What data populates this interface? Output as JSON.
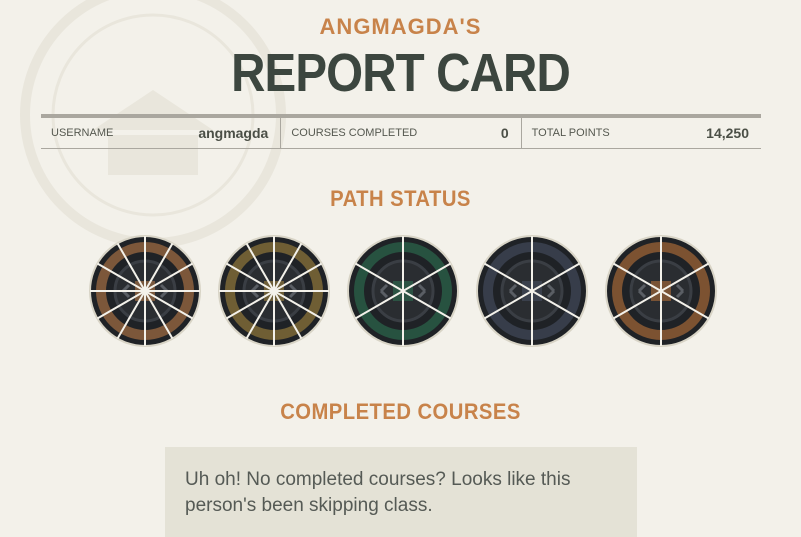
{
  "header": {
    "owner": "ANGMAGDA'S",
    "title": "REPORT CARD"
  },
  "stats": [
    {
      "label": "USERNAME",
      "value": "angmagda"
    },
    {
      "label": "COURSES COMPLETED",
      "value": "0"
    },
    {
      "label": "TOTAL POINTS",
      "value": "14,250"
    }
  ],
  "path_status": {
    "title": "PATH STATUS",
    "badges": [
      {
        "name": "path-badge-1",
        "segments": 12,
        "accent": "#c8834a",
        "base": "#2a2d31"
      },
      {
        "name": "path-badge-2",
        "segments": 12,
        "accent": "#b09040",
        "base": "#2a2d31"
      },
      {
        "name": "path-badge-3",
        "segments": 6,
        "accent": "#2e7a55",
        "base": "#2a2d31"
      },
      {
        "name": "path-badge-4",
        "segments": 6,
        "accent": "#4a5468",
        "base": "#2a2d31"
      },
      {
        "name": "path-badge-5",
        "segments": 6,
        "accent": "#c87a3a",
        "base": "#2a2d31"
      }
    ]
  },
  "completed_courses": {
    "title": "COMPLETED COURSES",
    "empty_message": "Uh oh! No completed courses? Looks like this person's been skipping class."
  }
}
